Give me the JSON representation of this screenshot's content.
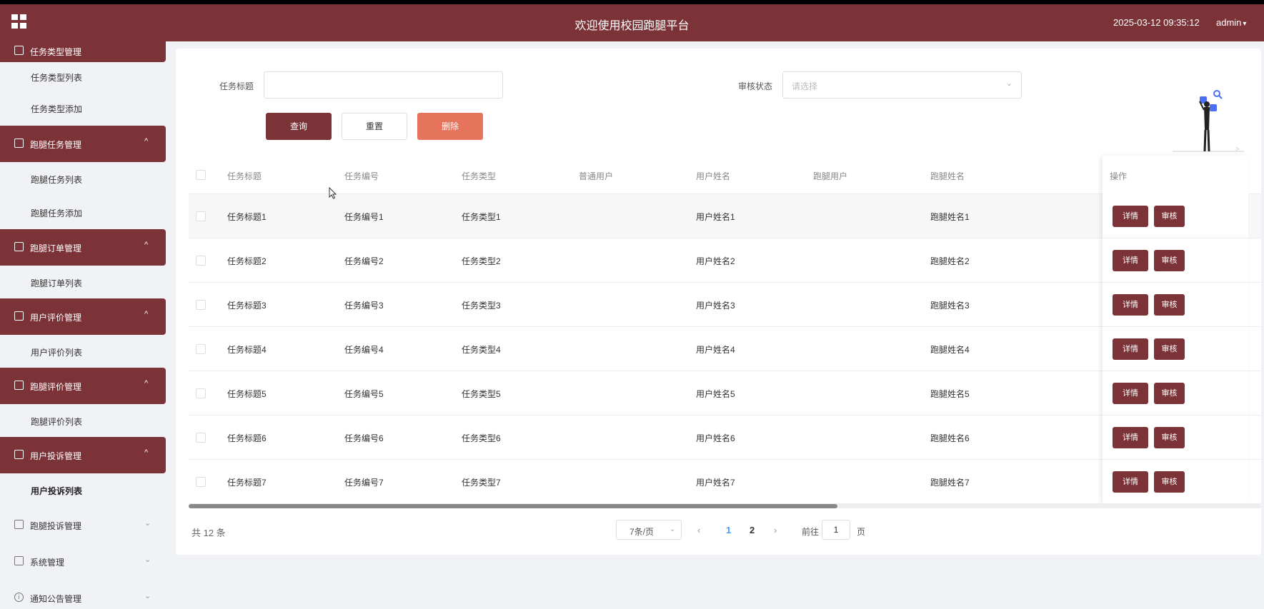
{
  "header": {
    "title": "欢迎使用校园跑腿平台",
    "datetime": "2025-03-12 09:35:12",
    "user": "admin"
  },
  "sidebar": {
    "top_group_partial": "任务类型管理",
    "items": [
      {
        "label": "任务类型列表"
      },
      {
        "label": "任务类型添加"
      }
    ],
    "groups": [
      {
        "label": "跑腿任务管理",
        "children": [
          "跑腿任务列表",
          "跑腿任务添加"
        ]
      },
      {
        "label": "跑腿订单管理",
        "children": [
          "跑腿订单列表"
        ]
      },
      {
        "label": "用户评价管理",
        "children": [
          "用户评价列表"
        ]
      },
      {
        "label": "跑腿评价管理",
        "children": [
          "跑腿评价列表"
        ]
      },
      {
        "label": "用户投诉管理",
        "children": [
          "用户投诉列表"
        ]
      }
    ],
    "collapsed": [
      {
        "label": "跑腿投诉管理",
        "icon": "folder-icon"
      },
      {
        "label": "系统管理",
        "icon": "image-icon"
      },
      {
        "label": "通知公告管理",
        "icon": "info-icon"
      }
    ]
  },
  "search": {
    "title_label": "任务标题",
    "title_value": "",
    "status_label": "审核状态",
    "status_placeholder": "请选择",
    "query_btn": "查询",
    "reset_btn": "重置",
    "delete_btn": "删除"
  },
  "table": {
    "columns": [
      "任务标题",
      "任务编号",
      "任务类型",
      "普通用户",
      "用户姓名",
      "跑腿用户",
      "跑腿姓名",
      "操作"
    ],
    "rows": [
      [
        "任务标题1",
        "任务编号1",
        "任务类型1",
        "",
        "用户姓名1",
        "",
        "跑腿姓名1"
      ],
      [
        "任务标题2",
        "任务编号2",
        "任务类型2",
        "",
        "用户姓名2",
        "",
        "跑腿姓名2"
      ],
      [
        "任务标题3",
        "任务编号3",
        "任务类型3",
        "",
        "用户姓名3",
        "",
        "跑腿姓名3"
      ],
      [
        "任务标题4",
        "任务编号4",
        "任务类型4",
        "",
        "用户姓名4",
        "",
        "跑腿姓名4"
      ],
      [
        "任务标题5",
        "任务编号5",
        "任务类型5",
        "",
        "用户姓名5",
        "",
        "跑腿姓名5"
      ],
      [
        "任务标题6",
        "任务编号6",
        "任务类型6",
        "",
        "用户姓名6",
        "",
        "跑腿姓名6"
      ],
      [
        "任务标题7",
        "任务编号7",
        "任务类型7",
        "",
        "用户姓名7",
        "",
        "跑腿姓名7"
      ]
    ],
    "detail_btn": "详情",
    "audit_btn": "审核"
  },
  "pagination": {
    "total": "共 12 条",
    "page_size": "7条/页",
    "pages": [
      "1",
      "2"
    ],
    "current": "1",
    "goto_label": "前往",
    "goto_value": "1",
    "goto_unit": "页"
  },
  "colors": {
    "brand": "#7b3338",
    "delete": "#e6735c",
    "active_page": "#409eff"
  }
}
